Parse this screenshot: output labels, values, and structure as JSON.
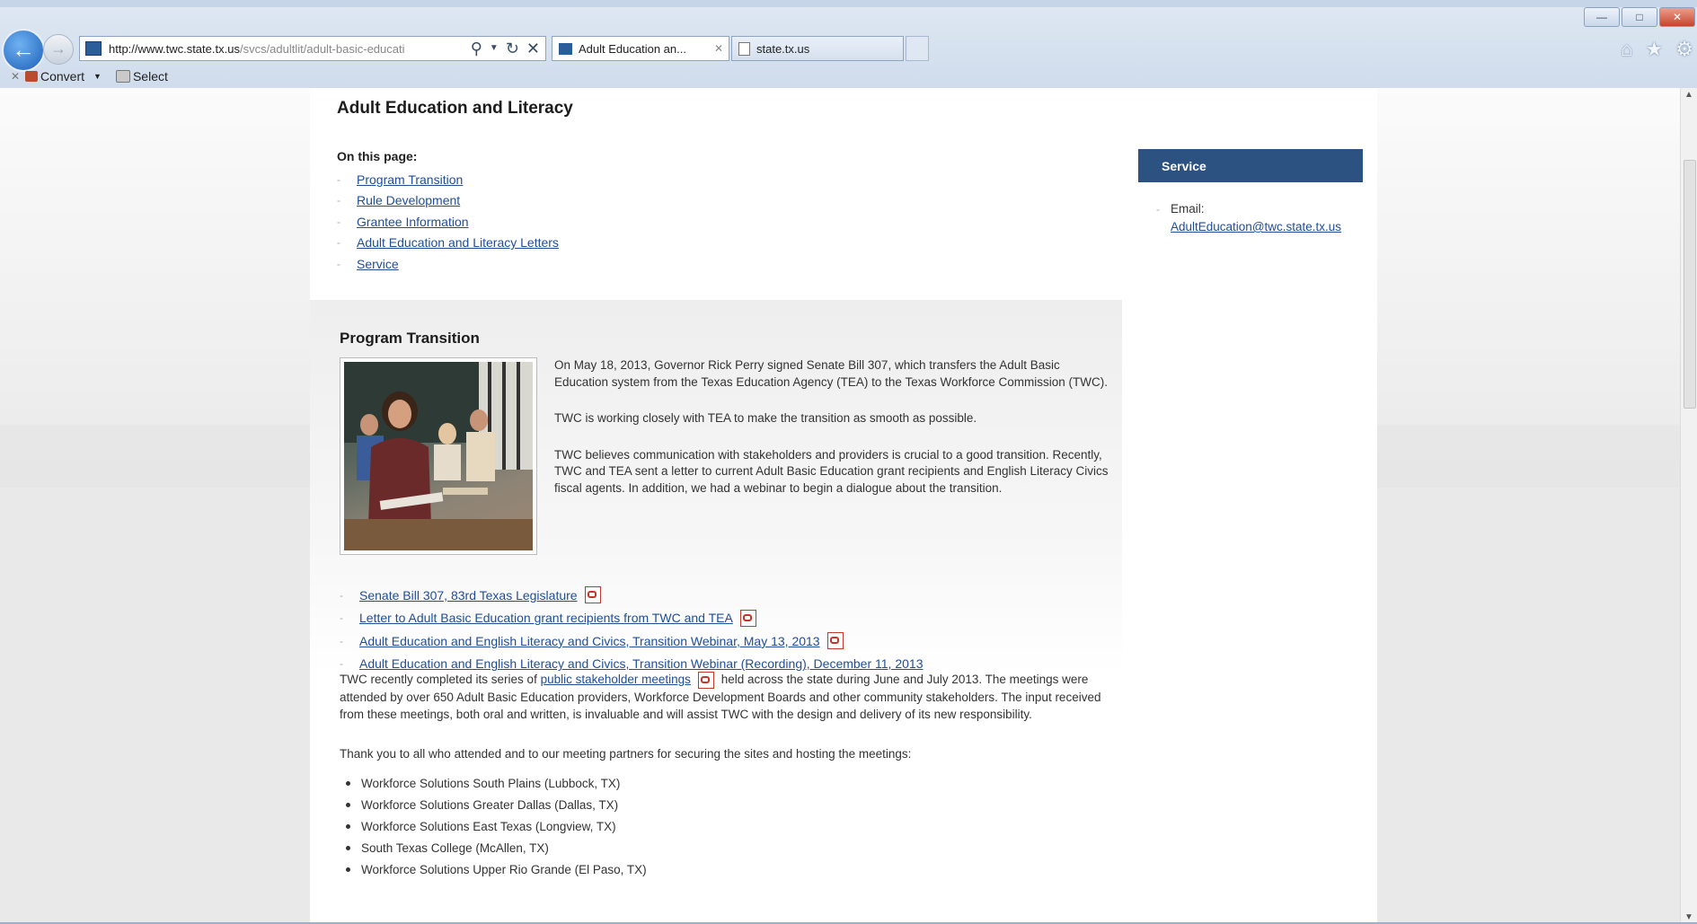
{
  "browser": {
    "address": {
      "host": "http://www.twc.state.tx.us",
      "path": "/svcs/adultlit/adult-basic-educati"
    },
    "tabs": [
      {
        "title": "Adult Education an...",
        "active": true
      },
      {
        "title": "state.tx.us",
        "active": false
      }
    ],
    "commandbar": {
      "convert_label": "Convert",
      "select_label": "Select"
    }
  },
  "page": {
    "title": "Adult Education and Literacy",
    "toc": {
      "heading": "On this page:",
      "items": [
        "Program Transition",
        "Rule Development",
        "Grantee Information",
        "Adult Education and Literacy Letters",
        "Service"
      ]
    },
    "program_transition": {
      "heading": "Program Transition",
      "paragraphs": [
        "On May 18, 2013, Governor Rick Perry signed Senate Bill 307, which transfers the Adult Basic Education system from the Texas Education Agency (TEA) to the Texas Workforce Commission (TWC).",
        "TWC is working closely with TEA to make the transition as smooth as possible.",
        "TWC believes communication with stakeholders and providers is crucial to a good transition. Recently, TWC and TEA sent a letter to current Adult Basic Education grant recipients and English Literacy Civics fiscal agents. In addition, we had a webinar to begin a dialogue about the transition."
      ],
      "links": [
        {
          "label": "Senate Bill 307, 83rd Texas Legislature",
          "pdf": true
        },
        {
          "label": "Letter to Adult Basic Education grant recipients from TWC and TEA",
          "pdf": true
        },
        {
          "label": "Adult Education and English Literacy and Civics, Transition Webinar, May 13, 2013",
          "pdf": true
        },
        {
          "label": "Adult Education and English Literacy and Civics, Transition Webinar (Recording), December 11, 2013",
          "pdf": false
        }
      ],
      "meetings_para_start": "TWC recently completed its series of ",
      "meetings_link": "public stakeholder meetings",
      "meetings_para_end": " held across the state during June and July 2013. The meetings were attended by over 650 Adult Basic Education providers, Workforce Development Boards and other community stakeholders. The input received from these meetings, both oral and written, is invaluable and will assist TWC with the design and delivery of its new responsibility.",
      "thanks": "Thank you to all who attended and to our meeting partners for securing the sites and hosting the meetings:",
      "partners": [
        "Workforce Solutions South Plains (Lubbock, TX)",
        "Workforce Solutions Greater Dallas (Dallas, TX)",
        "Workforce Solutions East Texas (Longview, TX)",
        "South Texas College (McAllen, TX)",
        "Workforce Solutions Upper Rio Grande (El Paso, TX)"
      ]
    },
    "sidebar": {
      "heading": "Service",
      "email_label": "Email:",
      "email": "AdultEducation@twc.state.tx.us"
    }
  }
}
